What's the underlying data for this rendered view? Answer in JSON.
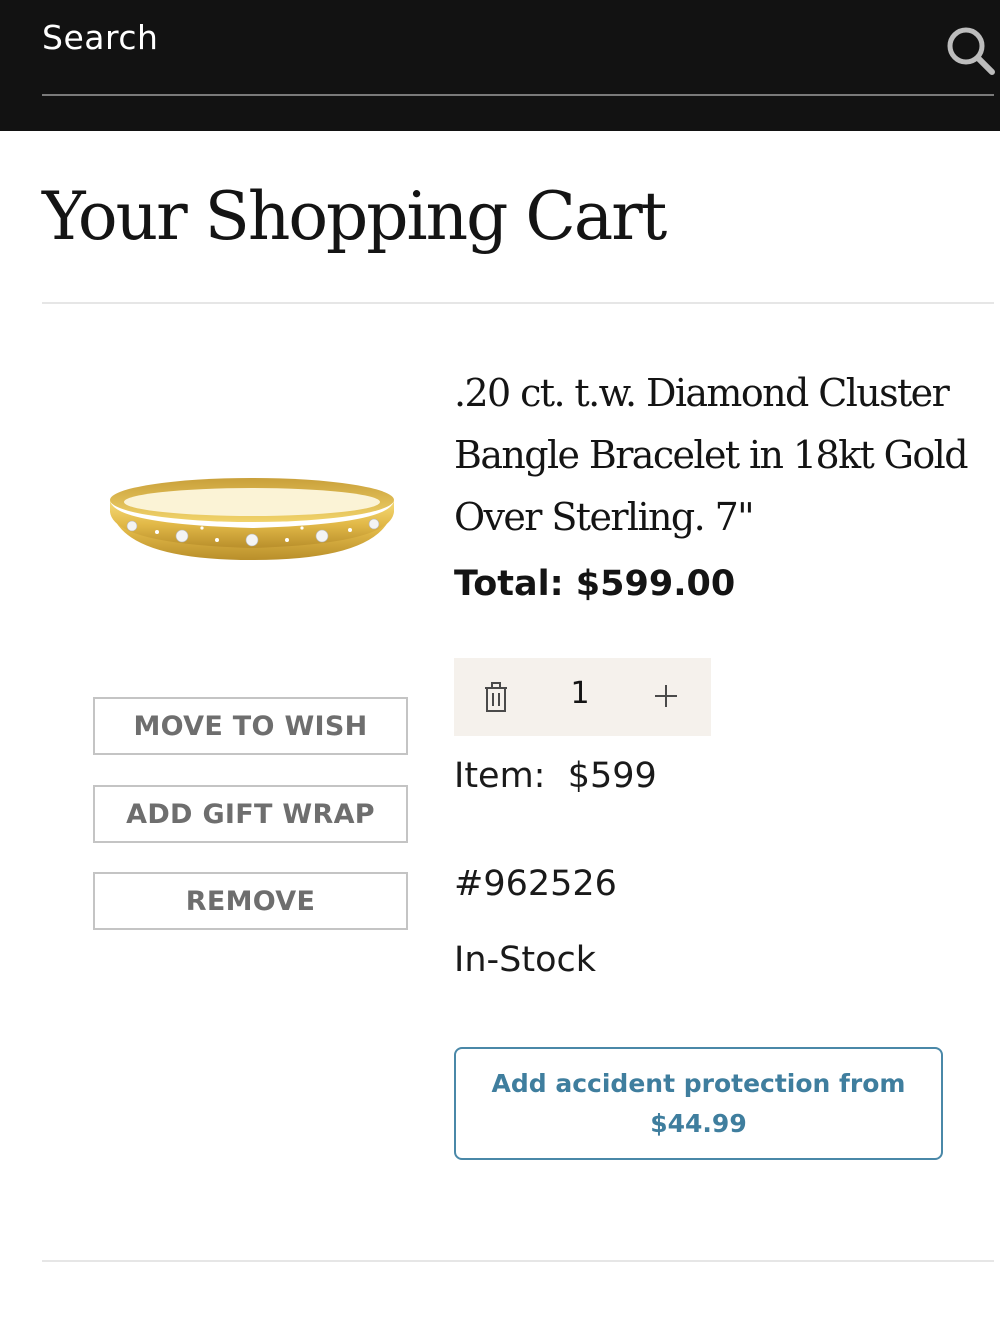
{
  "search": {
    "placeholder": "Search"
  },
  "page": {
    "title": "Your Shopping Cart"
  },
  "cart_item": {
    "name": ".20 ct. t.w. Diamond Cluster Bangle Bracelet in 18kt Gold Over Sterling. 7\"",
    "total_label": "Total: $599.00",
    "quantity": "1",
    "item_label": "Item:",
    "item_price": "$599",
    "sku": "#962526",
    "stock_status": "In-Stock",
    "image_icon": "gold-bangle-bracelet-image"
  },
  "actions": {
    "move_to_wish": "MOVE TO WISH",
    "add_gift_wrap": "ADD GIFT WRAP",
    "remove": "REMOVE"
  },
  "protection": {
    "label": "Add accident protection from $44.99"
  },
  "colors": {
    "header_bg": "#121212",
    "accent_blue": "#3f7e9e",
    "stepper_bg": "#f5f1ec",
    "gold": "#d9b44a"
  }
}
